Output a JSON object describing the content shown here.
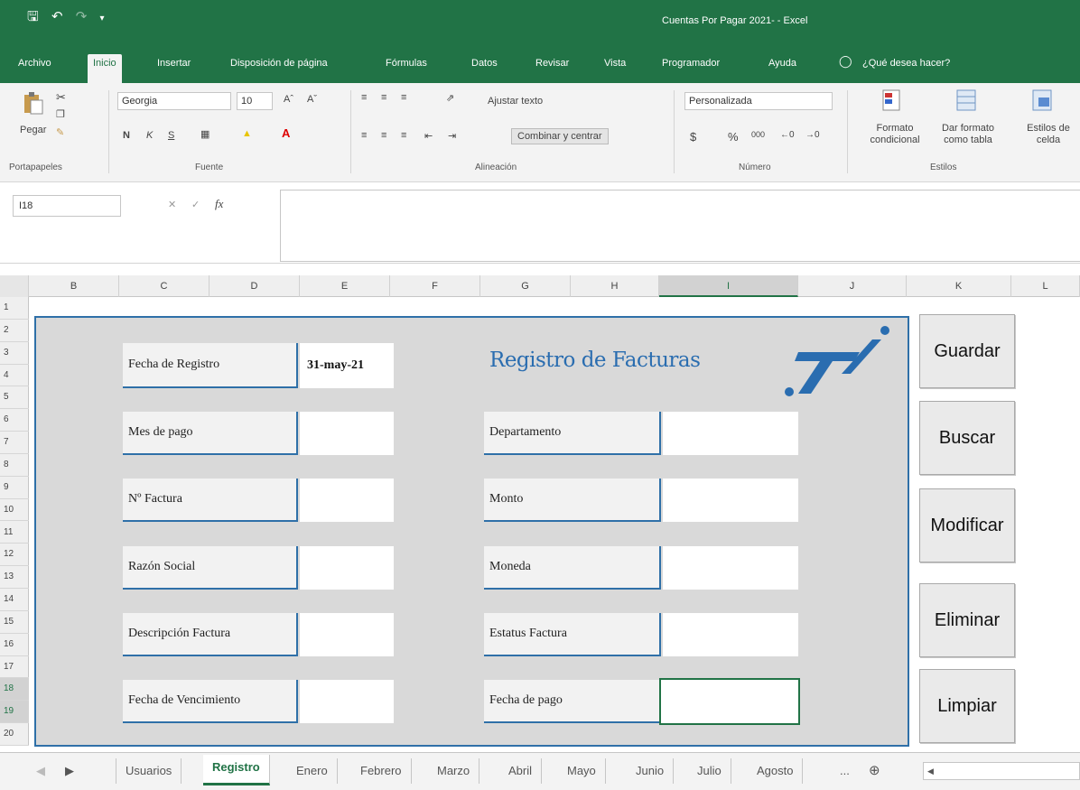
{
  "window": {
    "title": "Cuentas Por Pagar 2021-  -  Excel"
  },
  "ribbon_tabs": [
    "Archivo",
    "Inicio",
    "Insertar",
    "Disposición de página",
    "Fórmulas",
    "Datos",
    "Revisar",
    "Vista",
    "Programador",
    "Ayuda"
  ],
  "tell_me": "¿Qué desea hacer?",
  "ribbon": {
    "clipboard": {
      "paste": "Pegar",
      "label": "Portapapeles"
    },
    "font": {
      "name": "Georgia",
      "size": "10",
      "label": "Fuente",
      "bold": "N",
      "italic": "K",
      "underline": "S"
    },
    "alignment": {
      "wrap": "Ajustar texto",
      "merge": "Combinar y centrar",
      "label": "Alineación"
    },
    "number": {
      "format": "Personalizada",
      "currency": "$",
      "percent": "%",
      "thousands": "000",
      "label": "Número"
    },
    "styles": {
      "conditional": "Formato condicional",
      "as_table": "Dar formato como tabla",
      "cell_styles": "Estilos de celda",
      "label": "Estilos"
    }
  },
  "formula_bar": {
    "name_box": "I18",
    "fx": "fx"
  },
  "columns": [
    "B",
    "C",
    "D",
    "E",
    "F",
    "G",
    "H",
    "I",
    "J",
    "K",
    "L"
  ],
  "rows": [
    "1",
    "2",
    "3",
    "4",
    "5",
    "6",
    "7",
    "8",
    "9",
    "10",
    "11",
    "12",
    "13",
    "14",
    "15",
    "16",
    "17",
    "18",
    "19",
    "20"
  ],
  "form": {
    "title": "Registro de Facturas",
    "fecha_registro_label": "Fecha de Registro",
    "fecha_registro_value": "31-may-21",
    "left_fields": [
      "Mes de pago",
      "Nº Factura",
      "Razón Social",
      "Descripción Factura",
      "Fecha de Vencimiento"
    ],
    "right_fields": [
      "Departamento",
      "Monto",
      "Moneda",
      "Estatus Factura",
      "Fecha de pago"
    ]
  },
  "buttons": [
    "Guardar",
    "Buscar",
    "Modificar",
    "Eliminar",
    "Limpiar"
  ],
  "sheet_tabs": [
    "Usuarios",
    "Registro",
    "Enero",
    "Febrero",
    "Marzo",
    "Abril",
    "Mayo",
    "Junio",
    "Julio",
    "Agosto"
  ],
  "active_sheet": "Registro",
  "more_sheets": "...",
  "colors": {
    "excel_green": "#217346",
    "accent_blue": "#2f70a8",
    "panel_gray": "#d9d9d9"
  }
}
